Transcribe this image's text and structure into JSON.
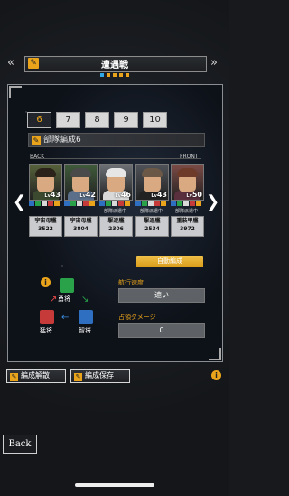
{
  "header": {
    "title": "遭遇戦",
    "left_arrows": "«",
    "right_arrows": "»"
  },
  "page_dots": {
    "count": 5,
    "active_index": 0
  },
  "tabs": [
    "6",
    "7",
    "8",
    "9",
    "10"
  ],
  "active_tab": "6",
  "fleet_name": "部隊編成6",
  "line_labels": {
    "back": "BACK",
    "front": "FRONT"
  },
  "cards": [
    {
      "level": "43",
      "sub": "",
      "ship": "宇宙母艦",
      "power": "3522",
      "hair": "#2b2219",
      "body": "#3b4a2e",
      "bg": "#55603a"
    },
    {
      "level": "42",
      "sub": "",
      "ship": "宇宙母艦",
      "power": "3804",
      "hair": "#4a4a4a",
      "body": "#5b6f8a",
      "bg": "#3f5a3a"
    },
    {
      "level": "46",
      "sub": "部隊派遣中",
      "ship": "駆逐艦",
      "power": "2306",
      "hair": "#e6e6e6",
      "body": "#d9d9d9",
      "bg": "#6b6f74"
    },
    {
      "level": "43",
      "sub": "部隊派遣中",
      "ship": "駆逐艦",
      "power": "2534",
      "hair": "#6b5846",
      "body": "#222222",
      "bg": "#4e5258"
    },
    {
      "level": "50",
      "sub": "部隊派遣中",
      "ship": "重装甲艦",
      "power": "3972",
      "hair": "#6e3b2a",
      "body": "#5a2f3d",
      "bg": "#7a4a45"
    }
  ],
  "level_prefix": "Lv",
  "nav": {
    "prev": "❮",
    "next": "❯"
  },
  "auto_button": "自動編成",
  "triangle": {
    "top": "勇将",
    "left": "猛将",
    "right": "智将"
  },
  "stats": [
    {
      "label": "航行速度",
      "value": "速い"
    },
    {
      "label": "占領ダメージ",
      "value": "0"
    }
  ],
  "bottom": {
    "disband": "編成解散",
    "save": "編成保存"
  },
  "back_button": "Back",
  "info_glyph": "i",
  "edit_glyph": "✎",
  "colors": {
    "accent": "#e9a41b",
    "active_dot": "#2fa8e8"
  }
}
